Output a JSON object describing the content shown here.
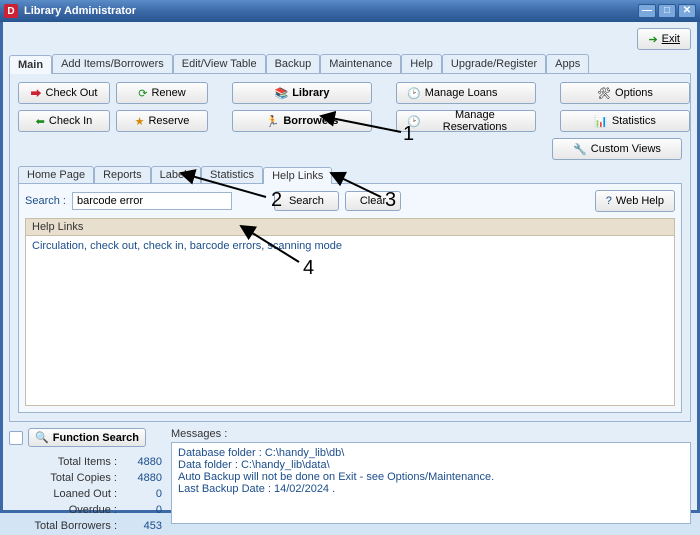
{
  "window": {
    "title": "Library Administrator"
  },
  "exit_label": "Exit",
  "main_tabs": [
    "Main",
    "Add Items/Borrowers",
    "Edit/View Table",
    "Backup",
    "Maintenance",
    "Help",
    "Upgrade/Register",
    "Apps"
  ],
  "buttons": {
    "check_out": "Check Out",
    "renew": "Renew",
    "library": "Library",
    "manage_loans": "Manage Loans",
    "options": "Options",
    "check_in": "Check In",
    "reserve": "Reserve",
    "borrowers": "Borrowers",
    "manage_res": "Manage Reservations",
    "statistics": "Statistics",
    "custom_views": "Custom Views"
  },
  "sub_tabs": [
    "Home Page",
    "Reports",
    "Labels",
    "Statistics",
    "Help Links"
  ],
  "search": {
    "label": "Search :",
    "value": "barcode error",
    "search_btn": "Search",
    "clear_btn": "Clear",
    "webhelp_btn": "Web Help"
  },
  "results_header": "Help Links",
  "results_line": "Circulation, check out, check in, barcode errors, scanning mode",
  "annotations": {
    "n1": "1",
    "n2": "2",
    "n3": "3",
    "n4": "4"
  },
  "footer": {
    "func_search": "Function Search",
    "messages_label": "Messages :",
    "stats": [
      {
        "k": "Total Items :",
        "v": "4880"
      },
      {
        "k": "Total Copies :",
        "v": "4880"
      },
      {
        "k": "Loaned Out :",
        "v": "0"
      },
      {
        "k": "Overdue :",
        "v": "0"
      },
      {
        "k": "Total Borrowers :",
        "v": "453"
      }
    ],
    "messages": [
      "Database folder : C:\\handy_lib\\db\\",
      "Data folder : C:\\handy_lib\\data\\",
      "Auto Backup will not be done on Exit - see Options/Maintenance.",
      "Last Backup Date : 14/02/2024 ."
    ]
  }
}
